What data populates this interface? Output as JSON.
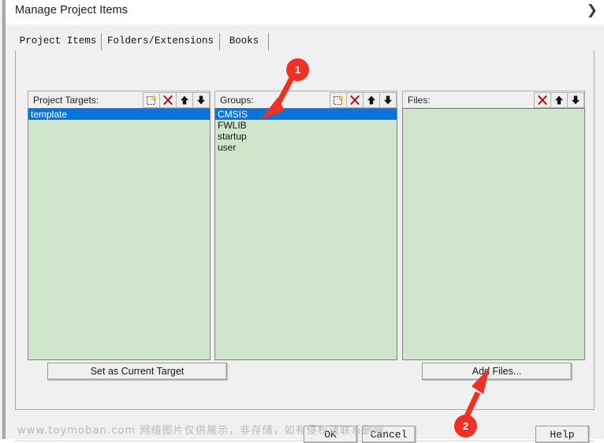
{
  "window": {
    "title": "Manage Project Items",
    "chevron_icon": "chevron-right-icon"
  },
  "tabs": [
    {
      "label": "Project Items",
      "active": true
    },
    {
      "label": "Folders/Extensions",
      "active": false
    },
    {
      "label": "Books",
      "active": false
    }
  ],
  "columns": {
    "targets": {
      "label": "Project Targets:",
      "buttons": [
        {
          "name": "new-item-button",
          "icon": "new-item-icon"
        },
        {
          "name": "delete-button",
          "icon": "red-x-icon"
        },
        {
          "name": "move-up-button",
          "icon": "arrow-up-icon"
        },
        {
          "name": "move-down-button",
          "icon": "arrow-down-icon"
        }
      ],
      "items": [
        {
          "text": "template",
          "selected": true
        }
      ]
    },
    "groups": {
      "label": "Groups:",
      "buttons": [
        {
          "name": "new-item-button",
          "icon": "new-item-icon"
        },
        {
          "name": "delete-button",
          "icon": "red-x-icon"
        },
        {
          "name": "move-up-button",
          "icon": "arrow-up-icon"
        },
        {
          "name": "move-down-button",
          "icon": "arrow-down-icon"
        }
      ],
      "items": [
        {
          "text": "CMSIS",
          "selected": true
        },
        {
          "text": "FWLIB",
          "selected": false
        },
        {
          "text": "startup",
          "selected": false
        },
        {
          "text": "user",
          "selected": false
        }
      ]
    },
    "files": {
      "label": "Files:",
      "buttons": [
        {
          "name": "delete-button",
          "icon": "red-x-icon"
        },
        {
          "name": "move-up-button",
          "icon": "arrow-up-icon"
        },
        {
          "name": "move-down-button",
          "icon": "arrow-down-icon"
        }
      ],
      "items": []
    }
  },
  "actions": {
    "set_current_target": "Set as Current Target",
    "add_files": "Add Files..."
  },
  "footer": {
    "ok": "OK",
    "cancel": "Cancel",
    "help": "Help"
  },
  "watermark": {
    "text": "www.toymoban.com 网络图片仅供展示，非存储，如有侵权请联系删除。"
  },
  "annotations": [
    {
      "label": "1",
      "target": "groups-list-cmsis"
    },
    {
      "label": "2",
      "target": "add-files-button"
    }
  ],
  "colors": {
    "selection_blue": "#0a74da",
    "list_green": "#cfe6cd",
    "annotation_red": "#ee3124",
    "dialog_gray": "#f0f0f0"
  }
}
